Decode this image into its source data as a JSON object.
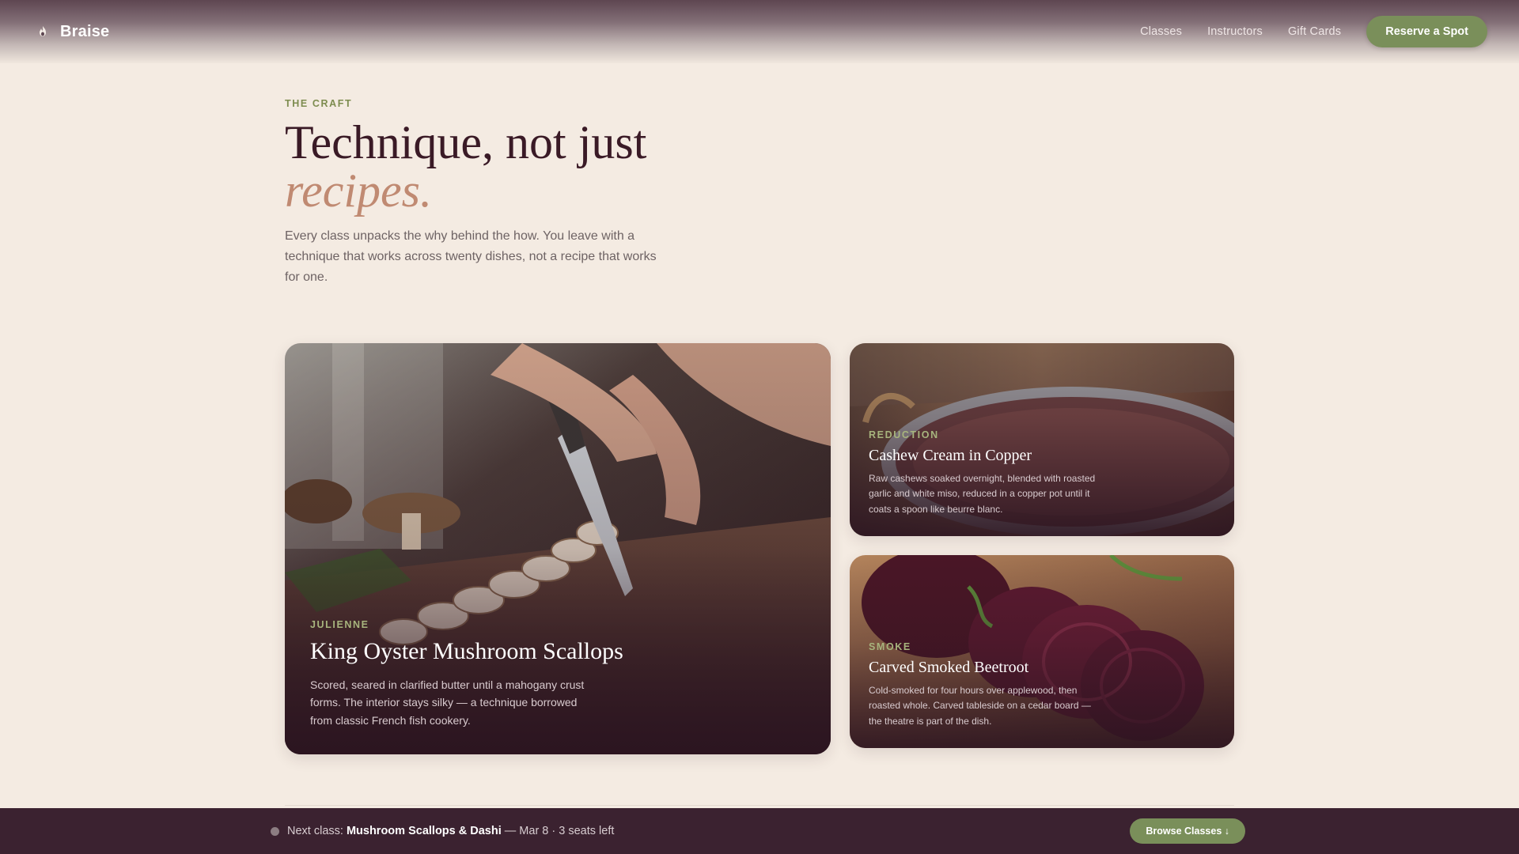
{
  "header": {
    "brand": "Braise",
    "nav": [
      "Classes",
      "Instructors",
      "Gift Cards"
    ],
    "cta": "Reserve a Spot"
  },
  "intro": {
    "eyebrow": "THE CRAFT",
    "headline_main": "Technique, not just",
    "headline_accent": "recipes.",
    "lede": "Every class unpacks the why behind the how. You leave with a technique that works across twenty dishes, not a recipe that works for one."
  },
  "cards": [
    {
      "tag": "JULIENNE",
      "title": "King Oyster Mushroom Scallops",
      "description": "Scored, seared in clarified butter until a mahogany crust forms. The interior stays silky — a technique borrowed from classic French fish cookery.",
      "photo": "knife-slicing-mushrooms"
    },
    {
      "tag": "REDUCTION",
      "title": "Cashew Cream in Copper",
      "description": "Raw cashews soaked overnight, blended with roasted garlic and white miso, reduced in a copper pot until it coats a spoon like beurre blanc.",
      "photo": "copper-pot-cream"
    },
    {
      "tag": "SMOKE",
      "title": "Carved Smoked Beetroot",
      "description": "Cold-smoked for four hours over applewood, then roasted whole. Carved tableside on a cedar board — the theatre is part of the dish.",
      "photo": "sliced-beetroot"
    }
  ],
  "bottom_bar": {
    "label": "Next class:",
    "class_name": "Mushroom Scallops & Dashi",
    "meta": "— Mar 8 · 3 seats left",
    "cta": "Browse Classes ↓"
  },
  "colors": {
    "background": "#f4ebe2",
    "accent_green": "#7a8f5a",
    "headline": "#3a1a26",
    "accent_italic": "#c08a72",
    "bottom_bar": "#3b2230"
  }
}
